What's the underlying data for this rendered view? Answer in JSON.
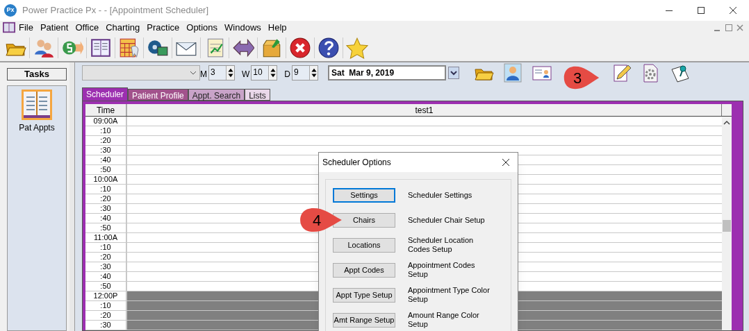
{
  "window": {
    "logo": "Px",
    "title": "Power Practice Px -  - [Appointment Scheduler]"
  },
  "menu": [
    "File",
    "Patient",
    "Office",
    "Charting",
    "Practice",
    "Options",
    "Windows",
    "Help"
  ],
  "tasks": {
    "title": "Tasks",
    "items": [
      {
        "label": "Pat Appts"
      }
    ]
  },
  "controls": {
    "spins": [
      {
        "label": "M",
        "value": "3"
      },
      {
        "label": "W",
        "value": "10"
      },
      {
        "label": "D",
        "value": "9"
      }
    ],
    "date": "Sat  Mar 9, 2019"
  },
  "tabs": [
    {
      "label": "Scheduler",
      "selected": true,
      "color": "#9c2fb0"
    },
    {
      "label": "Patient Profile",
      "selected": false,
      "color": "#a2528c"
    },
    {
      "label": "Appt. Search",
      "selected": false,
      "color": "#c8a3c8"
    },
    {
      "label": "Lists",
      "selected": false,
      "color": "#ead8ea"
    }
  ],
  "grid": {
    "columns": [
      "Time",
      "test1"
    ],
    "rows": [
      {
        "time": "09:00A",
        "blocked": false
      },
      {
        "time": ":10",
        "blocked": false
      },
      {
        "time": ":20",
        "blocked": false
      },
      {
        "time": ":30",
        "blocked": false
      },
      {
        "time": ":40",
        "blocked": false
      },
      {
        "time": ":50",
        "blocked": false
      },
      {
        "time": "10:00A",
        "blocked": false
      },
      {
        "time": ":10",
        "blocked": false
      },
      {
        "time": ":20",
        "blocked": false
      },
      {
        "time": ":30",
        "blocked": false
      },
      {
        "time": ":40",
        "blocked": false
      },
      {
        "time": ":50",
        "blocked": false
      },
      {
        "time": "11:00A",
        "blocked": false
      },
      {
        "time": ":10",
        "blocked": false
      },
      {
        "time": ":20",
        "blocked": false
      },
      {
        "time": ":30",
        "blocked": false
      },
      {
        "time": ":40",
        "blocked": false
      },
      {
        "time": ":50",
        "blocked": false
      },
      {
        "time": "12:00P",
        "blocked": true
      },
      {
        "time": ":10",
        "blocked": true
      },
      {
        "time": ":20",
        "blocked": true
      },
      {
        "time": ":30",
        "blocked": true
      }
    ]
  },
  "dialog": {
    "title": "Scheduler Options",
    "options": [
      {
        "button": "Settings",
        "description": "Scheduler Settings",
        "focused": true
      },
      {
        "button": "Chairs",
        "description": "Scheduler Chair Setup",
        "focused": false
      },
      {
        "button": "Locations",
        "description": "Scheduler Location Codes Setup",
        "focused": false
      },
      {
        "button": "Appt Codes",
        "description": "Appointment Codes Setup",
        "focused": false
      },
      {
        "button": "Appt Type Setup",
        "description": "Appointment Type Color Setup",
        "focused": false
      },
      {
        "button": "Amt Range Setup",
        "description": "Amount Range Color Setup",
        "focused": false
      }
    ]
  },
  "callouts": [
    {
      "label": "3"
    },
    {
      "label": "4"
    }
  ]
}
